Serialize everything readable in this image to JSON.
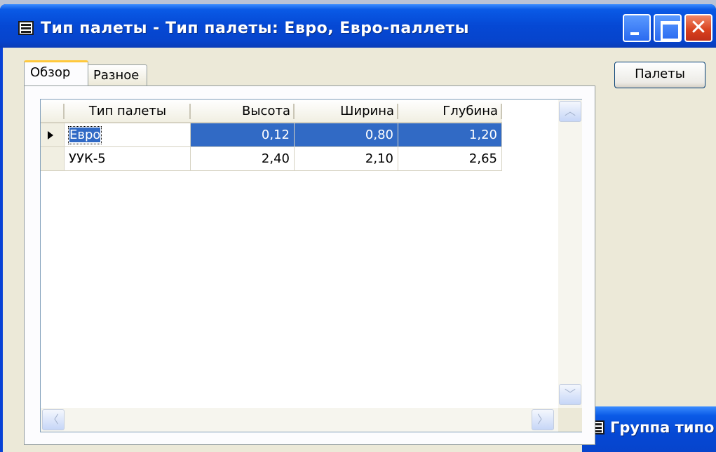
{
  "window": {
    "title": "Тип палеты - Тип палеты: Евро, Евро-паллеты"
  },
  "tabs": [
    {
      "label": "Обзор",
      "active": true
    },
    {
      "label": "Разное",
      "active": false
    }
  ],
  "grid": {
    "columns": [
      "Тип палеты",
      "Высота",
      "Ширина",
      "Глубина"
    ],
    "rows": [
      {
        "type": "Евро",
        "height": "0,12",
        "width": "0,80",
        "depth": "1,20",
        "selected": true
      },
      {
        "type": "УУК-5",
        "height": "2,40",
        "width": "2,10",
        "depth": "2,65",
        "selected": false
      }
    ]
  },
  "side_button": {
    "label": "Палеты"
  },
  "second_window": {
    "title": "Группа типо"
  },
  "icons": {
    "window_icon": "form-icon",
    "minimize": "minimize-icon",
    "maximize": "maximize-icon",
    "close": "close-icon",
    "row_pointer": "row-pointer-icon",
    "scroll_up": "chevron-up-icon",
    "scroll_down": "chevron-down-icon",
    "scroll_left": "chevron-left-icon",
    "scroll_right": "chevron-right-icon"
  },
  "colors": {
    "titlebar": "#0548d4",
    "selection": "#316ac5",
    "client": "#ece9d8",
    "close_button": "#d8401c"
  }
}
